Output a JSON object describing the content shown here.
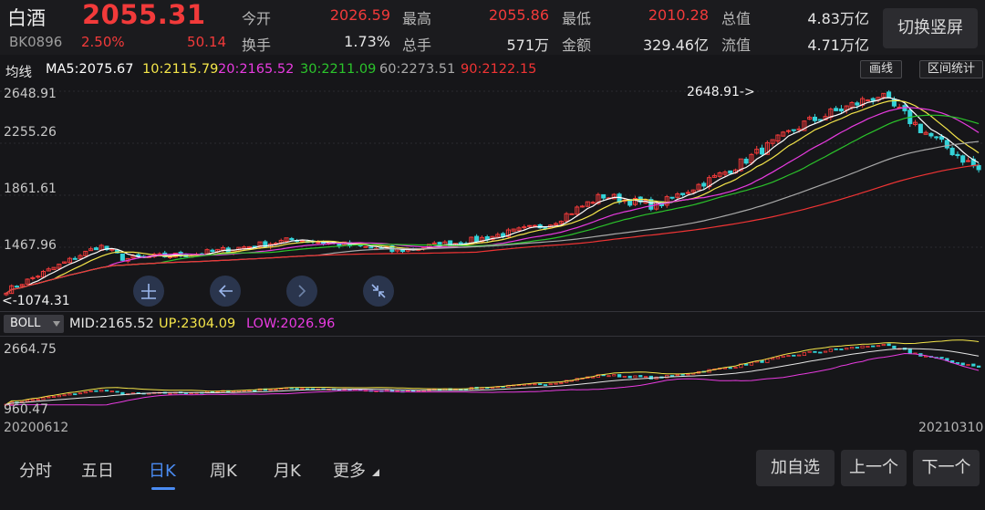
{
  "header": {
    "name": "白酒",
    "code": "BK0896",
    "price": "2055.31",
    "pct_change": "2.50%",
    "change": "50.14",
    "fields": [
      {
        "label": "今开",
        "value": "2026.59",
        "color": "#f23a3a"
      },
      {
        "label": "最高",
        "value": "2055.86",
        "color": "#f23a3a"
      },
      {
        "label": "最低",
        "value": "2010.28",
        "color": "#f23a3a"
      },
      {
        "label": "总值",
        "value": "4.83万亿",
        "color": "#e4e4e4"
      },
      {
        "label": "换手",
        "value": "1.73%",
        "color": "#e4e4e4"
      },
      {
        "label": "总手",
        "value": "571万",
        "color": "#e4e4e4"
      },
      {
        "label": "金额",
        "value": "329.46亿",
        "color": "#e4e4e4"
      },
      {
        "label": "流值",
        "value": "4.71万亿",
        "color": "#e4e4e4"
      }
    ],
    "toggle_label": "切换竖屏"
  },
  "ma_legend": {
    "title": "均线",
    "items": [
      {
        "text": "MA5:2075.67",
        "color": "#ffffff"
      },
      {
        "text": "10:2115.79",
        "color": "#f5e64a"
      },
      {
        "text": "20:2165.52",
        "color": "#e83be0"
      },
      {
        "text": "30:2211.09",
        "color": "#2bc42b"
      },
      {
        "text": "60:2273.51",
        "color": "#a9a9a9"
      },
      {
        "text": "90:2122.15",
        "color": "#f03434"
      }
    ],
    "draw_label": "画线",
    "range_label": "区间统计"
  },
  "main_axis": {
    "labels": [
      "2648.91",
      "2255.26",
      "1861.61",
      "1467.96"
    ],
    "max_annotation": "2648.91->",
    "min_annotation": "<-1074.31"
  },
  "boll_legend": {
    "indicator": "BOLL",
    "mid": "MID:2165.52",
    "up": "UP:2304.09",
    "low": "LOW:2026.96",
    "mid_color": "#e6e6e6",
    "up_color": "#f5e64a",
    "low_color": "#e83be0"
  },
  "boll_axis": {
    "labels": [
      "2664.75",
      "960.47"
    ]
  },
  "dates": {
    "start": "20200612",
    "end": "20210310"
  },
  "tabs": [
    {
      "label": "分时"
    },
    {
      "label": "五日"
    },
    {
      "label": "日K"
    },
    {
      "label": "周K"
    },
    {
      "label": "月K"
    },
    {
      "label": "更多"
    }
  ],
  "buttons": {
    "add_watchlist": "加自选",
    "prev": "上一个",
    "next": "下一个"
  },
  "colors": {
    "up": "#f23a3a",
    "down": "#34d2d8",
    "accent": "#4a8bf2"
  },
  "chart_data": {
    "type": "candlestick",
    "date_range": [
      "20200612",
      "20210310"
    ],
    "ylim": [
      1074.31,
      2648.91
    ],
    "y_ticks": [
      2648.91,
      2255.26,
      1861.61,
      1467.96
    ],
    "approx_close_path": [
      {
        "date": "2020-06-12",
        "close": 1140
      },
      {
        "date": "2020-07-08",
        "close": 1480
      },
      {
        "date": "2020-07-15",
        "close": 1380
      },
      {
        "date": "2020-08-05",
        "close": 1420
      },
      {
        "date": "2020-09-01",
        "close": 1530
      },
      {
        "date": "2020-09-28",
        "close": 1440
      },
      {
        "date": "2020-10-20",
        "close": 1520
      },
      {
        "date": "2020-11-10",
        "close": 1640
      },
      {
        "date": "2020-11-25",
        "close": 1860
      },
      {
        "date": "2020-12-10",
        "close": 1780
      },
      {
        "date": "2020-12-31",
        "close": 2060
      },
      {
        "date": "2021-01-20",
        "close": 2400
      },
      {
        "date": "2021-02-10",
        "close": 2620
      },
      {
        "date": "2021-02-25",
        "close": 2300
      },
      {
        "date": "2021-03-10",
        "close": 2055.31
      }
    ],
    "last_ma": {
      "MA5": 2075.67,
      "MA10": 2115.79,
      "MA20": 2165.52,
      "MA30": 2211.09,
      "MA60": 2273.51,
      "MA90": 2122.15
    },
    "boll": {
      "mid": 2165.52,
      "up": 2304.09,
      "low": 2026.96,
      "ylim": [
        960.47,
        2664.75
      ]
    }
  }
}
